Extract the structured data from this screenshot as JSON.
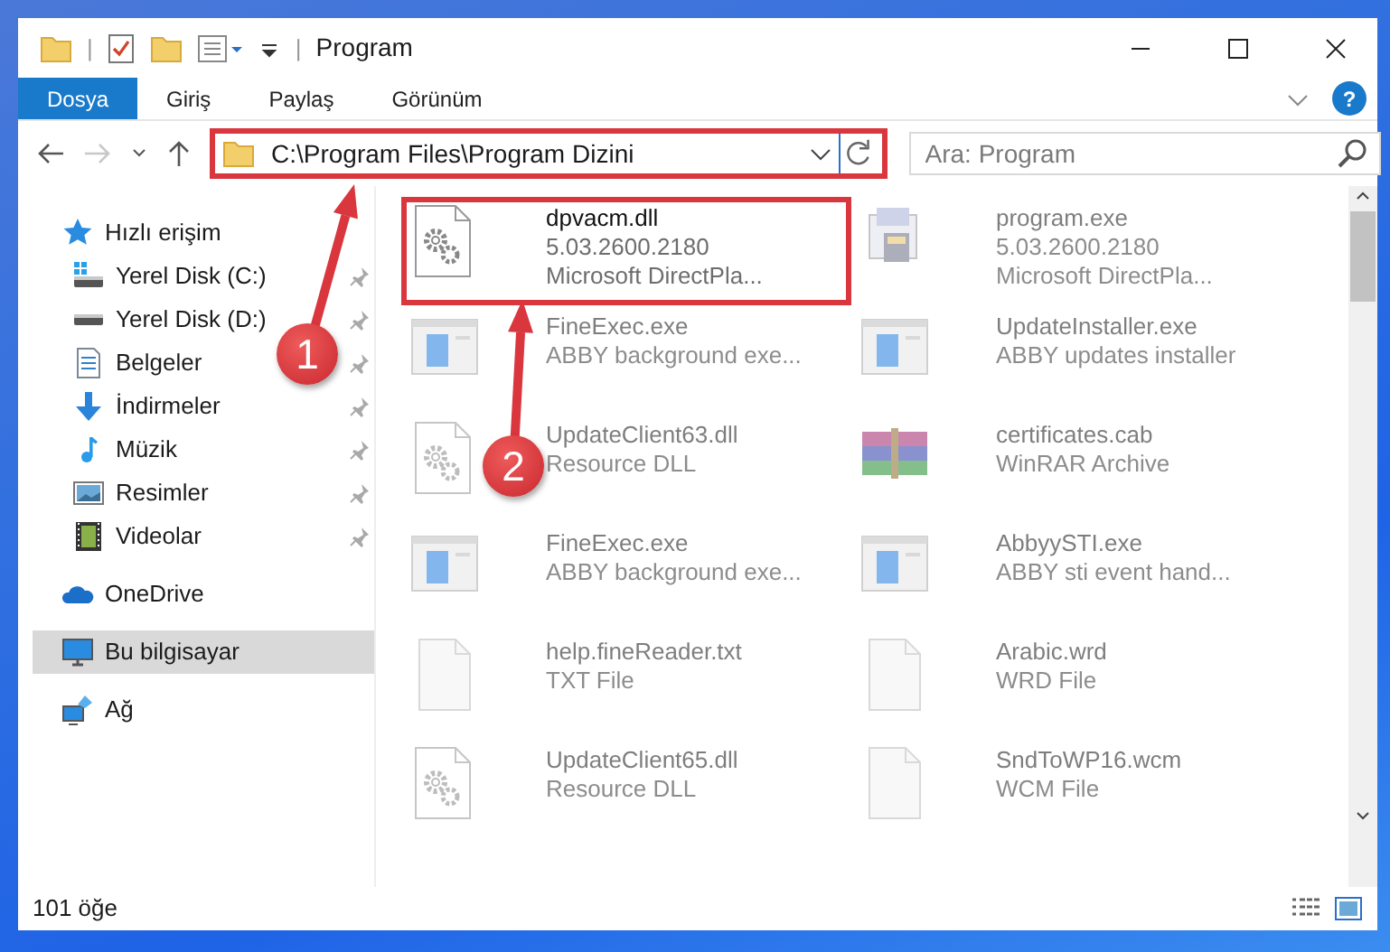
{
  "window": {
    "title": "Program"
  },
  "quick_access_toolbar": {
    "separator": "|"
  },
  "ribbon_tabs": [
    {
      "label": "Dosya",
      "selected": true
    },
    {
      "label": "Giriş",
      "selected": false
    },
    {
      "label": "Paylaş",
      "selected": false
    },
    {
      "label": "Görünüm",
      "selected": false
    }
  ],
  "help": "?",
  "navigation": {
    "forward_disabled": true,
    "address": "C:\\Program Files\\Program Dizini",
    "search": {
      "placeholder": "Ara: Program"
    }
  },
  "sidebar": {
    "items": [
      {
        "label": "Hızlı erişim",
        "selected": false,
        "children": [
          {
            "label": "Yerel Disk (C:)",
            "pinned": true,
            "selected": false
          },
          {
            "label": "Yerel Disk (D:)",
            "pinned": true,
            "selected": false
          },
          {
            "label": "Belgeler",
            "pinned": true,
            "selected": false
          },
          {
            "label": "İndirmeler",
            "pinned": true,
            "selected": false
          },
          {
            "label": "Müzik",
            "pinned": true,
            "selected": false
          },
          {
            "label": "Resimler",
            "pinned": true,
            "selected": false
          },
          {
            "label": "Videolar",
            "pinned": true,
            "selected": false
          }
        ]
      },
      {
        "label": "OneDrive",
        "selected": false
      },
      {
        "label": "Bu bilgisayar",
        "selected": true
      },
      {
        "label": "Ağ",
        "selected": false
      }
    ]
  },
  "files": [
    {
      "name": "dpvacm.dll",
      "lines": [
        "5.03.2600.2180",
        "Microsoft DirectPla..."
      ],
      "kind": "gear",
      "faded": false,
      "highlighted": true
    },
    {
      "name": "program.exe",
      "lines": [
        "5.03.2600.2180",
        "Microsoft DirectPla..."
      ],
      "kind": "installer",
      "faded": true,
      "highlighted": false
    },
    {
      "name": "FineExec.exe",
      "lines": [
        "ABBY background exe..."
      ],
      "kind": "app",
      "faded": true,
      "highlighted": false
    },
    {
      "name": "UpdateInstaller.exe",
      "lines": [
        "ABBY updates installer"
      ],
      "kind": "app",
      "faded": true,
      "highlighted": false
    },
    {
      "name": "UpdateClient63.dll",
      "lines": [
        "Resource DLL"
      ],
      "kind": "gear",
      "faded": true,
      "highlighted": false
    },
    {
      "name": "certificates.cab",
      "lines": [
        "WinRAR Archive"
      ],
      "kind": "archive",
      "faded": true,
      "highlighted": false
    },
    {
      "name": "FineExec.exe",
      "lines": [
        "ABBY background exe..."
      ],
      "kind": "app",
      "faded": true,
      "highlighted": false
    },
    {
      "name": "AbbyySTI.exe",
      "lines": [
        "ABBY sti event hand..."
      ],
      "kind": "app",
      "faded": true,
      "highlighted": false
    },
    {
      "name": "help.fineReader.txt",
      "lines": [
        "TXT File"
      ],
      "kind": "blank",
      "faded": true,
      "highlighted": false
    },
    {
      "name": "Arabic.wrd",
      "lines": [
        "WRD File"
      ],
      "kind": "blank",
      "faded": true,
      "highlighted": false
    },
    {
      "name": "UpdateClient65.dll",
      "lines": [
        "Resource DLL"
      ],
      "kind": "gear",
      "faded": true,
      "highlighted": false
    },
    {
      "name": "SndToWP16.wcm",
      "lines": [
        "WCM File"
      ],
      "kind": "blank",
      "faded": true,
      "highlighted": false
    }
  ],
  "status_bar": {
    "item_count": "101 öğe"
  },
  "annotations": {
    "address_highlighted": true,
    "steps": [
      {
        "label": "1"
      },
      {
        "label": "2"
      }
    ]
  }
}
